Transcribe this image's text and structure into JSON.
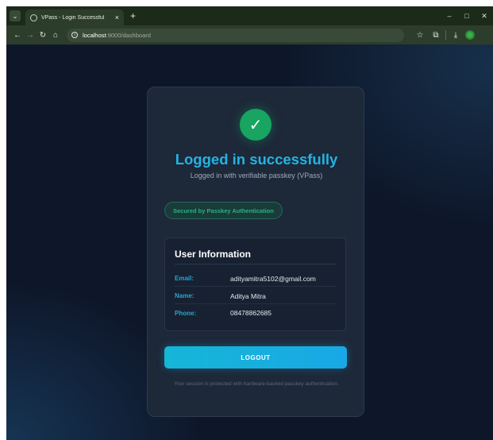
{
  "browser": {
    "tab_title": "VPass - Login Successful",
    "tab_close": "×",
    "new_tab": "+",
    "window_controls": {
      "minimize": "–",
      "maximize": "□",
      "close": "✕"
    },
    "url_host": "localhost",
    "url_path": ":9000/dashboard",
    "icons": [
      "back-icon",
      "forward-icon",
      "reload-icon",
      "home-icon",
      "star-icon",
      "extensions-icon",
      "download-icon",
      "profile-icon"
    ]
  },
  "card": {
    "check_glyph": "✓",
    "title": "Logged in successfully",
    "subtitle": "Logged in with verifiable passkey (VPass)",
    "badge": "Secured by Passkey Authentication",
    "info": {
      "heading": "User Information",
      "rows": [
        {
          "label": "Email:",
          "value": "adityamitra5102@gmail.com"
        },
        {
          "label": "Name:",
          "value": "Aditya Mitra"
        },
        {
          "label": "Phone:",
          "value": "08478862685"
        }
      ]
    },
    "logout_label": "LOGOUT",
    "footer": "Your session is protected with hardware-backed passkey authentication."
  },
  "colors": {
    "accent": "#23b4e3",
    "success": "#17a561",
    "background": "#0e172a",
    "card": "#1d2839"
  }
}
